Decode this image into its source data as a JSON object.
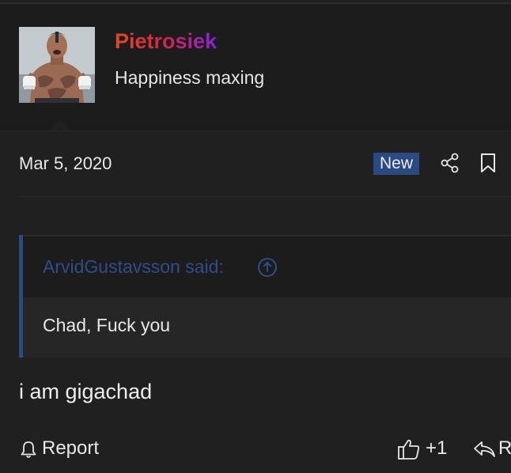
{
  "user": {
    "username": "Pietrosiek",
    "title": "Happiness maxing"
  },
  "post": {
    "date": "Mar 5, 2020",
    "badge": "New",
    "icons": {
      "share": "share-icon",
      "bookmark": "bookmark-icon"
    }
  },
  "quote": {
    "author": "ArvidGustavsson said:",
    "text": "Chad, Fuck you",
    "jump_icon": "arrow-up-circle-icon"
  },
  "message": {
    "text": "i am gigachad"
  },
  "actions": {
    "report_label": "Report",
    "like_count": "+1",
    "reply_label": "Reply"
  },
  "colors": {
    "background": "#202020",
    "accent": "#2b4a83",
    "username_gradient": [
      "#e0492a",
      "#d2263f",
      "#8a22d9"
    ]
  }
}
